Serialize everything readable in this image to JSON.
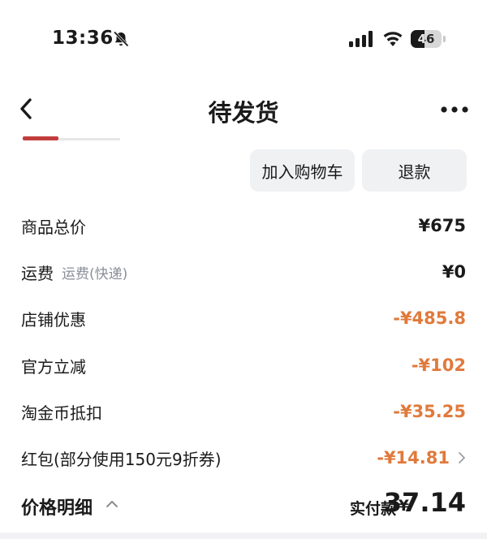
{
  "status_bar": {
    "time": "13:36",
    "battery": "46",
    "battery_level": 0.46
  },
  "nav": {
    "title": "待发货"
  },
  "actions": {
    "add_to_cart": "加入购物车",
    "refund": "退款"
  },
  "price_rows": [
    {
      "label": "商品总价",
      "sub": "",
      "value": "¥675"
    },
    {
      "label": "运费",
      "sub": "运费(快递)",
      "value": "¥0"
    },
    {
      "label": "店铺优惠",
      "sub": "",
      "value": "-¥485.8"
    },
    {
      "label": "官方立减",
      "sub": "",
      "value": "-¥102"
    },
    {
      "label": "淘金币抵扣",
      "sub": "",
      "value": "-¥35.25"
    },
    {
      "label": "红包(部分使用150元9折券)",
      "sub": "",
      "value": "-¥14.81"
    }
  ],
  "footer": {
    "title": "价格明细",
    "pay_label": "实付款",
    "currency": "¥",
    "amount": "37.14"
  },
  "colors": {
    "discount": "#e07a3c",
    "text": "#1a1a1a",
    "muted": "#8a8f9a",
    "button_bg": "#f0f1f3"
  }
}
